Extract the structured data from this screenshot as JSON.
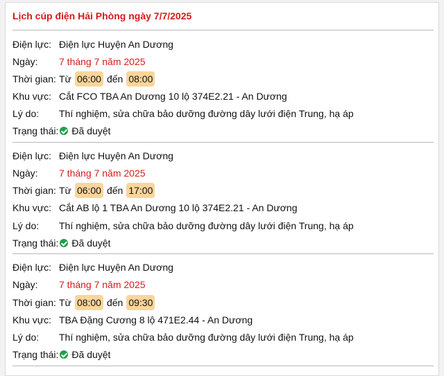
{
  "title": "Lịch cúp điện Hải Phòng ngày 7/7/2025",
  "labels": {
    "dien_luc": "Điện lực:",
    "ngay": "Ngày:",
    "thoi_gian": "Thời gian:",
    "tu": "Từ",
    "den": "đến",
    "khu_vuc": "Khu vực:",
    "ly_do": "Lý do:",
    "trang_thai": "Trạng thái:"
  },
  "colors": {
    "accent_red": "#d71a1a",
    "time_highlight": "#fad59b",
    "approved_green": "#21a04a"
  },
  "status_icon": "check-circle-icon",
  "entries": [
    {
      "dien_luc": "Điện lực Huyện An Dương",
      "ngay": "7 tháng 7 năm 2025",
      "start": "06:00",
      "end": "08:00",
      "khu_vuc": "Cắt FCO TBA An Dương 10 lộ 374E2.21 - An Dương",
      "ly_do": "Thí nghiệm, sửa chữa bảo dưỡng đường dây lưới điện Trung, hạ áp",
      "trang_thai": "Đã duyệt"
    },
    {
      "dien_luc": "Điện lực Huyện An Dương",
      "ngay": "7 tháng 7 năm 2025",
      "start": "06:00",
      "end": "17:00",
      "khu_vuc": "Cắt AB lộ 1 TBA An Dương 10 lộ 374E2.21 - An Dương",
      "ly_do": "Thí nghiệm, sửa chữa bảo dưỡng đường dây lưới điện Trung, hạ áp",
      "trang_thai": "Đã duyệt"
    },
    {
      "dien_luc": "Điện lực Huyện An Dương",
      "ngay": "7 tháng 7 năm 2025",
      "start": "08:00",
      "end": "09:30",
      "khu_vuc": "TBA Đặng Cương 8 lộ 471E2.44 - An Dương",
      "ly_do": "Thí nghiệm, sửa chữa bảo dưỡng đường dây lưới điện Trung, hạ áp",
      "trang_thai": "Đã duyệt"
    }
  ]
}
